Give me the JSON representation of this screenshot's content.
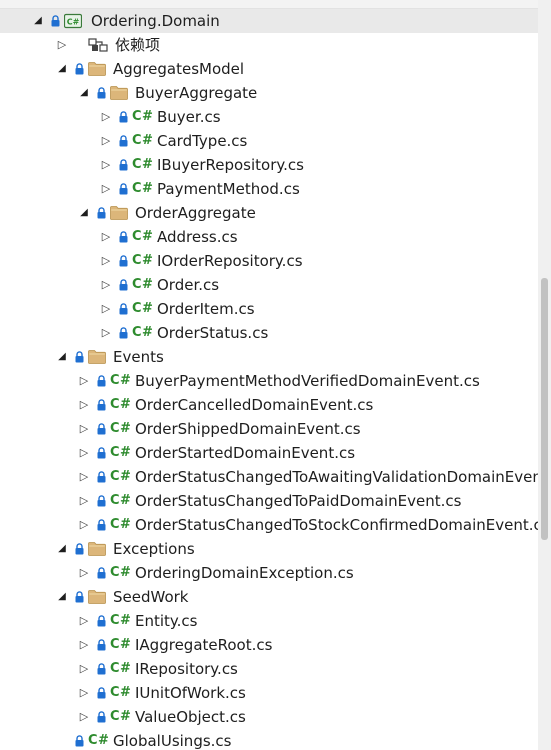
{
  "tree": {
    "rows": [
      {
        "label": "Ordering.Domain",
        "kind": "project",
        "depth": 0,
        "expander": "open",
        "lock": true,
        "selected": true
      },
      {
        "label": "依赖项",
        "kind": "dependencies",
        "depth": 1,
        "expander": "closed",
        "lock": false
      },
      {
        "label": "AggregatesModel",
        "kind": "folder",
        "depth": 1,
        "expander": "open",
        "lock": true
      },
      {
        "label": "BuyerAggregate",
        "kind": "folder",
        "depth": 2,
        "expander": "open",
        "lock": true
      },
      {
        "label": "Buyer.cs",
        "kind": "csharp",
        "depth": 3,
        "expander": "closed",
        "lock": true
      },
      {
        "label": "CardType.cs",
        "kind": "csharp",
        "depth": 3,
        "expander": "closed",
        "lock": true
      },
      {
        "label": "IBuyerRepository.cs",
        "kind": "csharp",
        "depth": 3,
        "expander": "closed",
        "lock": true
      },
      {
        "label": "PaymentMethod.cs",
        "kind": "csharp",
        "depth": 3,
        "expander": "closed",
        "lock": true
      },
      {
        "label": "OrderAggregate",
        "kind": "folder",
        "depth": 2,
        "expander": "open",
        "lock": true
      },
      {
        "label": "Address.cs",
        "kind": "csharp",
        "depth": 3,
        "expander": "closed",
        "lock": true
      },
      {
        "label": "IOrderRepository.cs",
        "kind": "csharp",
        "depth": 3,
        "expander": "closed",
        "lock": true
      },
      {
        "label": "Order.cs",
        "kind": "csharp",
        "depth": 3,
        "expander": "closed",
        "lock": true
      },
      {
        "label": "OrderItem.cs",
        "kind": "csharp",
        "depth": 3,
        "expander": "closed",
        "lock": true
      },
      {
        "label": "OrderStatus.cs",
        "kind": "csharp",
        "depth": 3,
        "expander": "closed",
        "lock": true
      },
      {
        "label": "Events",
        "kind": "folder",
        "depth": 1,
        "expander": "open",
        "lock": true
      },
      {
        "label": "BuyerPaymentMethodVerifiedDomainEvent.cs",
        "kind": "csharp",
        "depth": 2,
        "expander": "closed",
        "lock": true
      },
      {
        "label": "OrderCancelledDomainEvent.cs",
        "kind": "csharp",
        "depth": 2,
        "expander": "closed",
        "lock": true
      },
      {
        "label": "OrderShippedDomainEvent.cs",
        "kind": "csharp",
        "depth": 2,
        "expander": "closed",
        "lock": true
      },
      {
        "label": "OrderStartedDomainEvent.cs",
        "kind": "csharp",
        "depth": 2,
        "expander": "closed",
        "lock": true
      },
      {
        "label": "OrderStatusChangedToAwaitingValidationDomainEven",
        "kind": "csharp",
        "depth": 2,
        "expander": "closed",
        "lock": true
      },
      {
        "label": "OrderStatusChangedToPaidDomainEvent.cs",
        "kind": "csharp",
        "depth": 2,
        "expander": "closed",
        "lock": true
      },
      {
        "label": "OrderStatusChangedToStockConfirmedDomainEvent.c",
        "kind": "csharp",
        "depth": 2,
        "expander": "closed",
        "lock": true
      },
      {
        "label": "Exceptions",
        "kind": "folder",
        "depth": 1,
        "expander": "open",
        "lock": true
      },
      {
        "label": "OrderingDomainException.cs",
        "kind": "csharp",
        "depth": 2,
        "expander": "closed",
        "lock": true
      },
      {
        "label": "SeedWork",
        "kind": "folder",
        "depth": 1,
        "expander": "open",
        "lock": true
      },
      {
        "label": "Entity.cs",
        "kind": "csharp",
        "depth": 2,
        "expander": "closed",
        "lock": true
      },
      {
        "label": "IAggregateRoot.cs",
        "kind": "csharp",
        "depth": 2,
        "expander": "closed",
        "lock": true
      },
      {
        "label": "IRepository.cs",
        "kind": "csharp",
        "depth": 2,
        "expander": "closed",
        "lock": true
      },
      {
        "label": "IUnitOfWork.cs",
        "kind": "csharp",
        "depth": 2,
        "expander": "closed",
        "lock": true
      },
      {
        "label": "ValueObject.cs",
        "kind": "csharp",
        "depth": 2,
        "expander": "closed",
        "lock": true
      },
      {
        "label": "GlobalUsings.cs",
        "kind": "csharp",
        "depth": 1,
        "expander": "none",
        "lock": true
      }
    ]
  },
  "icons": {
    "csharp_text": "C#",
    "csharp_color": "#2e8b2e",
    "folder_color": "#dcb67a",
    "lock_color": "#1f6fd1",
    "selection_color": "#e9e9e9"
  }
}
